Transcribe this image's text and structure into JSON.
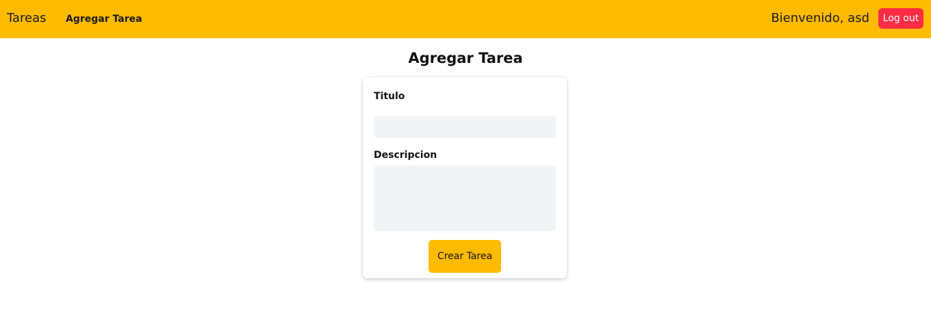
{
  "navbar": {
    "brand": "Tareas",
    "link_add_task": "Agregar Tarea",
    "welcome": "Bienvenido, asd",
    "logout_label": "Log out"
  },
  "page": {
    "title": "Agregar Tarea"
  },
  "form": {
    "title_label": "Titulo",
    "title_value": "",
    "description_label": "Descripcion",
    "description_value": "",
    "submit_label": "Crear Tarea"
  },
  "colors": {
    "navbar_bg": "#ffbb00",
    "logout_bg": "#fb2c44",
    "submit_bg": "#ffbb00",
    "input_bg": "#f2f3f5"
  }
}
